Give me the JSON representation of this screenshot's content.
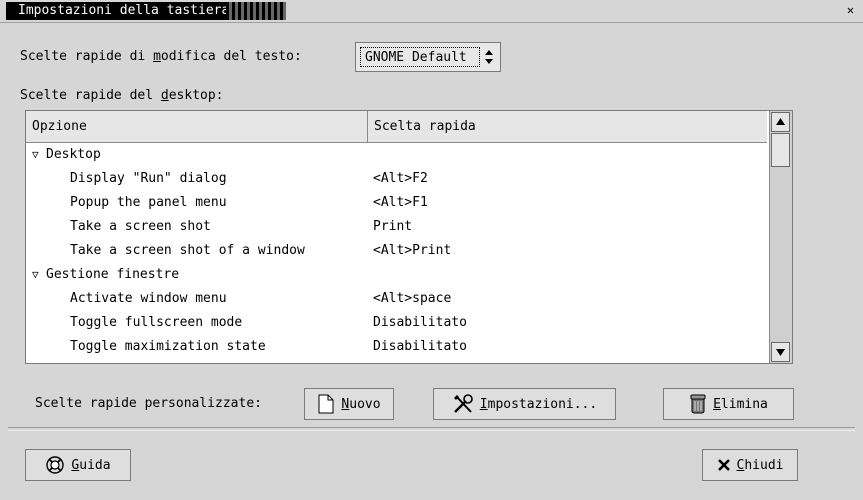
{
  "window": {
    "title": "Impostazioni della tastiera"
  },
  "text_edit": {
    "label_pre": "Scelte rapide di ",
    "label_mnemonic": "m",
    "label_post": "odifica del testo:",
    "value": "GNOME Default"
  },
  "desktop": {
    "label_pre": "Scelte rapide del ",
    "label_mnemonic": "d",
    "label_post": "esktop:"
  },
  "table": {
    "col_option": "Opzione",
    "col_shortcut": "Scelta rapida",
    "rows": [
      {
        "option": "Desktop",
        "shortcut": ""
      },
      {
        "option": "Display \"Run\" dialog",
        "shortcut": "<Alt>F2"
      },
      {
        "option": "Popup the panel menu",
        "shortcut": "<Alt>F1"
      },
      {
        "option": "Take a screen shot",
        "shortcut": "Print"
      },
      {
        "option": "Take a screen shot of a window",
        "shortcut": "<Alt>Print"
      },
      {
        "option": "Gestione finestre",
        "shortcut": ""
      },
      {
        "option": "Activate window menu",
        "shortcut": "<Alt>space"
      },
      {
        "option": "Toggle fullscreen mode",
        "shortcut": "Disabilitato"
      },
      {
        "option": "Toggle maximization state",
        "shortcut": "Disabilitato"
      }
    ]
  },
  "custom": {
    "label": "Scelte rapide personalizzate:",
    "new_mn": "N",
    "new_rest": "uovo",
    "settings_mn": "I",
    "settings_rest": "mpostazioni...",
    "delete_mn": "E",
    "delete_rest": "limina"
  },
  "footer": {
    "help_mn": "G",
    "help_rest": "uida",
    "close_mn": "C",
    "close_rest": "hiudi"
  }
}
